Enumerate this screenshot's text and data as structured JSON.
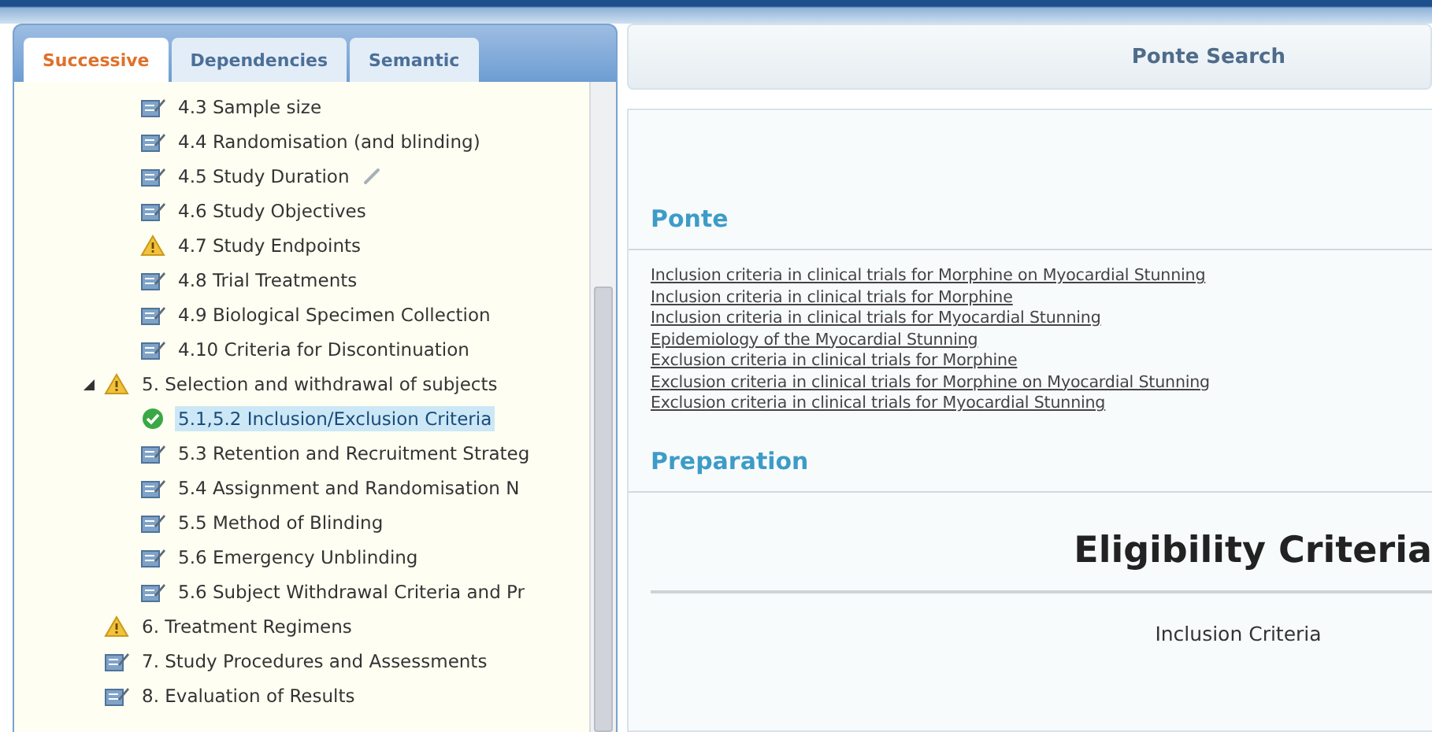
{
  "tabs": [
    {
      "label": "Successive",
      "selected": true
    },
    {
      "label": "Dependencies",
      "selected": false
    },
    {
      "label": "Semantic",
      "selected": false
    }
  ],
  "tree": {
    "continued_children": [
      {
        "label": "4.3 Sample size",
        "kind": "edit",
        "selected": false
      },
      {
        "label": "4.4 Randomisation (and blinding)",
        "kind": "edit",
        "selected": false
      },
      {
        "label": "4.5 Study Duration",
        "kind": "edit",
        "selected": false,
        "linked": true
      },
      {
        "label": "4.6 Study Objectives",
        "kind": "edit",
        "selected": false
      },
      {
        "label": "4.7 Study Endpoints",
        "kind": "warning",
        "selected": false
      },
      {
        "label": "4.8 Trial Treatments",
        "kind": "edit",
        "selected": false
      },
      {
        "label": "4.9 Biological Specimen Collection",
        "kind": "edit",
        "selected": false
      },
      {
        "label": "4.10 Criteria for Discontinuation",
        "kind": "edit",
        "selected": false
      }
    ],
    "items": [
      {
        "label": "5. Selection and withdrawal of subjects",
        "kind": "warning",
        "selected": false,
        "expanded": true,
        "children": [
          {
            "label": "5.1,5.2 Inclusion/Exclusion Criteria",
            "kind": "done",
            "selected": true
          },
          {
            "label": "5.3 Retention and Recruitment Strateg",
            "kind": "edit",
            "selected": false
          },
          {
            "label": "5.4 Assignment and Randomisation N",
            "kind": "edit",
            "selected": false
          },
          {
            "label": "5.5 Method of Blinding",
            "kind": "edit",
            "selected": false
          },
          {
            "label": "5.6 Emergency Unblinding",
            "kind": "edit",
            "selected": false
          },
          {
            "label": "5.6 Subject Withdrawal Criteria and Pr",
            "kind": "edit",
            "selected": false
          }
        ]
      },
      {
        "label": "6. Treatment Regimens",
        "kind": "warning",
        "selected": false
      },
      {
        "label": "7. Study Procedures and Assessments",
        "kind": "edit",
        "selected": false
      },
      {
        "label": "8. Evaluation of Results",
        "kind": "edit",
        "selected": false
      }
    ]
  },
  "search": {
    "title": "Ponte Search",
    "sections": [
      {
        "heading": "Ponte",
        "links": [
          "Inclusion criteria in clinical trials for Morphine on Myocardial Stunning",
          "Inclusion criteria in clinical trials for Morphine",
          "Inclusion criteria in clinical trials for Myocardial Stunning",
          "Epidemiology of the Myocardial Stunning",
          "Exclusion criteria in clinical trials for Morphine",
          "Exclusion criteria in clinical trials for Morphine on Myocardial Stunning",
          "Exclusion criteria in clinical trials for Myocardial Stunning"
        ]
      },
      {
        "heading": "Preparation"
      }
    ],
    "document": {
      "title": "Eligibility Criteria",
      "subtitle": "Inclusion Criteria"
    }
  }
}
